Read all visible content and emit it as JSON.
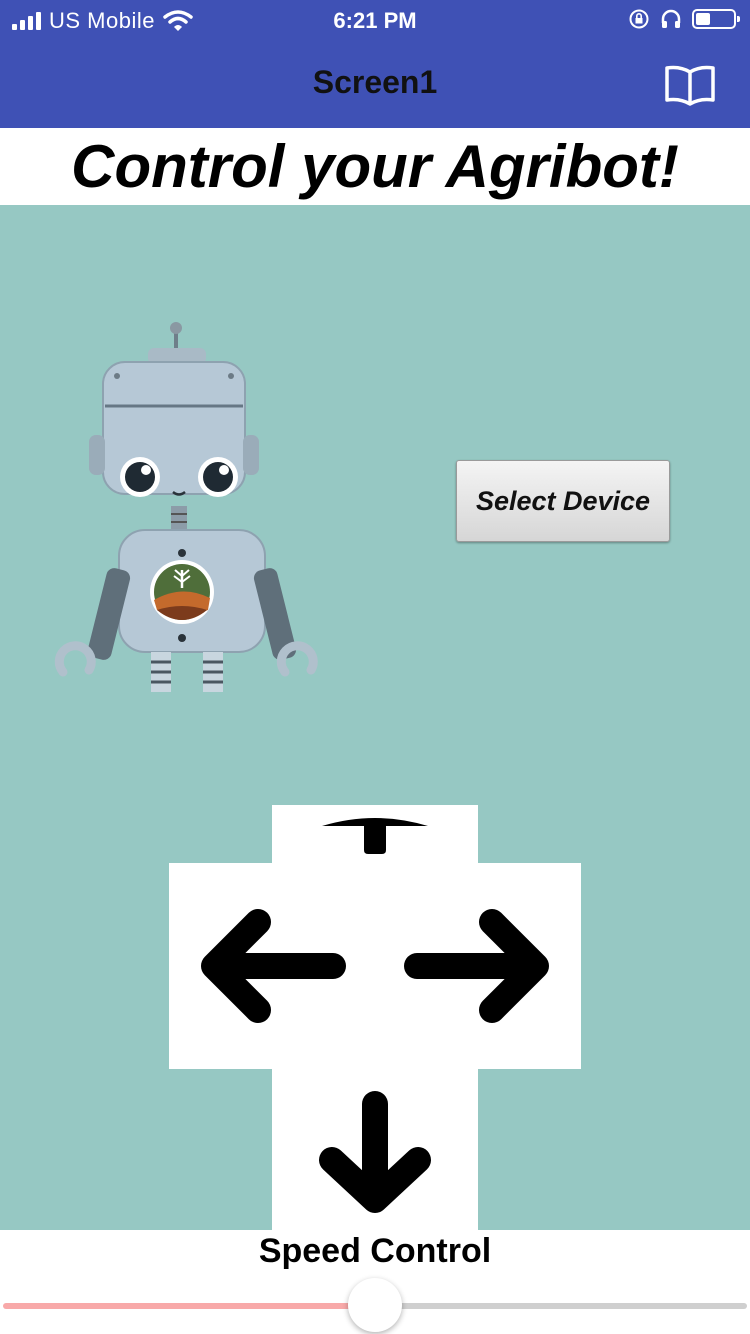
{
  "status_bar": {
    "carrier": "US  Mobile",
    "time": "6:21 PM",
    "icons": [
      "signal-icon",
      "wifi-icon",
      "orientation-lock-icon",
      "headphones-icon",
      "battery-icon"
    ]
  },
  "app_bar": {
    "title": "Screen1",
    "icon": "book-icon",
    "color": "#3F51B5"
  },
  "heading": "Control your Agribot!",
  "main": {
    "background": "#96C8C3",
    "robot_image": "robot-image",
    "select_device_button": "Select Device"
  },
  "direction_pad": {
    "buttons": [
      "arrow-up-button",
      "arrow-left-button",
      "arrow-right-button",
      "arrow-down-button"
    ]
  },
  "speed": {
    "label": "Speed Control",
    "value_fraction": 0.5,
    "colors": {
      "filled": "#F8A9A9",
      "empty": "#CFCFCF"
    }
  }
}
